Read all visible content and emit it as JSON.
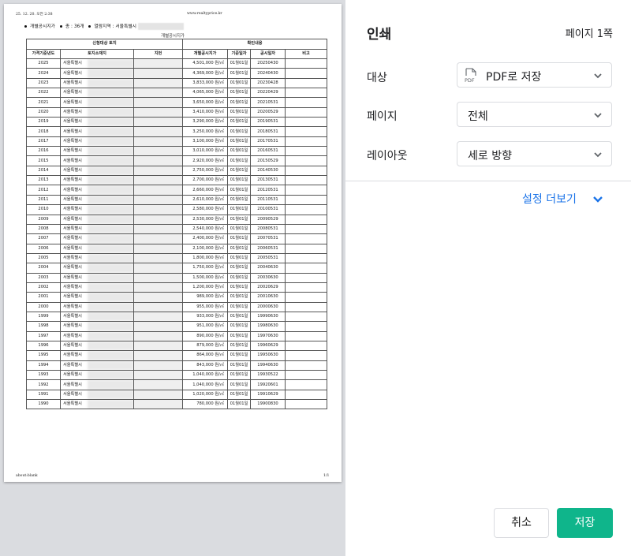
{
  "preview": {
    "header_datetime": "25. 12. 20. 오전 2:38",
    "header_url": "www.realtyprice.kr",
    "info_type": "개별공시지가",
    "info_count": "총 : 36개",
    "info_region": "열람지역 : 서울특별시",
    "doc_title": "개별공시지가",
    "group_headers": [
      "신청대상 토지",
      "확인내용"
    ],
    "col_headers": [
      "가격기준년도",
      "토지소재지",
      "지번",
      "개별공시지가",
      "기준일자",
      "공시일자",
      "비고"
    ],
    "rows": [
      [
        "2025",
        "서울특별시",
        "4,501,000 원/㎡",
        "01월01일",
        "20250430"
      ],
      [
        "2024",
        "서울특별시",
        "4,369,000 원/㎡",
        "01월01일",
        "20240430"
      ],
      [
        "2023",
        "서울특별시",
        "3,833,000 원/㎡",
        "01월01일",
        "20230428"
      ],
      [
        "2022",
        "서울특별시",
        "4,065,000 원/㎡",
        "01월01일",
        "20220429"
      ],
      [
        "2021",
        "서울특별시",
        "3,650,000 원/㎡",
        "01월01일",
        "20210531"
      ],
      [
        "2020",
        "서울특별시",
        "3,410,000 원/㎡",
        "01월01일",
        "20200529"
      ],
      [
        "2019",
        "서울특별시",
        "3,290,000 원/㎡",
        "01월01일",
        "20190531"
      ],
      [
        "2018",
        "서울특별시",
        "3,250,000 원/㎡",
        "01월01일",
        "20180531"
      ],
      [
        "2017",
        "서울특별시",
        "3,100,000 원/㎡",
        "01월01일",
        "20170531"
      ],
      [
        "2016",
        "서울특별시",
        "3,010,000 원/㎡",
        "01월01일",
        "20160531"
      ],
      [
        "2015",
        "서울특별시",
        "2,920,000 원/㎡",
        "01월01일",
        "20150529"
      ],
      [
        "2014",
        "서울특별시",
        "2,750,000 원/㎡",
        "01월01일",
        "20140530"
      ],
      [
        "2013",
        "서울특별시",
        "2,700,000 원/㎡",
        "01월01일",
        "20130531"
      ],
      [
        "2012",
        "서울특별시",
        "2,660,000 원/㎡",
        "01월01일",
        "20120531"
      ],
      [
        "2011",
        "서울특별시",
        "2,610,000 원/㎡",
        "01월01일",
        "20110531"
      ],
      [
        "2010",
        "서울특별시",
        "2,580,000 원/㎡",
        "01월01일",
        "20100531"
      ],
      [
        "2009",
        "서울특별시",
        "2,530,000 원/㎡",
        "01월01일",
        "20090529"
      ],
      [
        "2008",
        "서울특별시",
        "2,540,000 원/㎡",
        "01월01일",
        "20080531"
      ],
      [
        "2007",
        "서울특별시",
        "2,400,000 원/㎡",
        "01월01일",
        "20070531"
      ],
      [
        "2006",
        "서울특별시",
        "2,100,000 원/㎡",
        "01월01일",
        "20060531"
      ],
      [
        "2005",
        "서울특별시",
        "1,800,000 원/㎡",
        "01월01일",
        "20050531"
      ],
      [
        "2004",
        "서울특별시",
        "1,750,000 원/㎡",
        "01월01일",
        "20040630"
      ],
      [
        "2003",
        "서울특별시",
        "1,500,000 원/㎡",
        "01월01일",
        "20030630"
      ],
      [
        "2002",
        "서울특별시",
        "1,200,000 원/㎡",
        "01월01일",
        "20020629"
      ],
      [
        "2001",
        "서울특별시",
        "989,000 원/㎡",
        "01월01일",
        "20010630"
      ],
      [
        "2000",
        "서울특별시",
        "955,000 원/㎡",
        "01월01일",
        "20000630"
      ],
      [
        "1999",
        "서울특별시",
        "933,000 원/㎡",
        "01월01일",
        "19990630"
      ],
      [
        "1998",
        "서울특별시",
        "951,000 원/㎡",
        "01월01일",
        "19980630"
      ],
      [
        "1997",
        "서울특별시",
        "890,000 원/㎡",
        "01월01일",
        "19970630"
      ],
      [
        "1996",
        "서울특별시",
        "879,000 원/㎡",
        "01월01일",
        "19960629"
      ],
      [
        "1995",
        "서울특별시",
        "864,000 원/㎡",
        "01월01일",
        "19950630"
      ],
      [
        "1994",
        "서울특별시",
        "843,000 원/㎡",
        "01월01일",
        "19940630"
      ],
      [
        "1993",
        "서울특별시",
        "1,040,000 원/㎡",
        "01월01일",
        "19930522"
      ],
      [
        "1992",
        "서울특별시",
        "1,040,000 원/㎡",
        "01월01일",
        "19920601"
      ],
      [
        "1991",
        "서울특별시",
        "1,020,000 원/㎡",
        "01월01일",
        "19910629"
      ],
      [
        "1990",
        "서울특별시",
        "780,000 원/㎡",
        "01월01일",
        "19900830"
      ]
    ],
    "footer_url": "about:blank",
    "footer_page": "1/1"
  },
  "panel": {
    "title": "인쇄",
    "page_count": "페이지 1쪽",
    "destination_label": "대상",
    "destination_value": "PDF로 저장",
    "destination_icon_text": "PDF",
    "pages_label": "페이지",
    "pages_value": "전체",
    "layout_label": "레이아웃",
    "layout_value": "세로 방향",
    "more_settings": "설정 더보기",
    "cancel_label": "취소",
    "save_label": "저장",
    "accent_color": "#0fb58b",
    "link_color": "#1a73e8"
  }
}
